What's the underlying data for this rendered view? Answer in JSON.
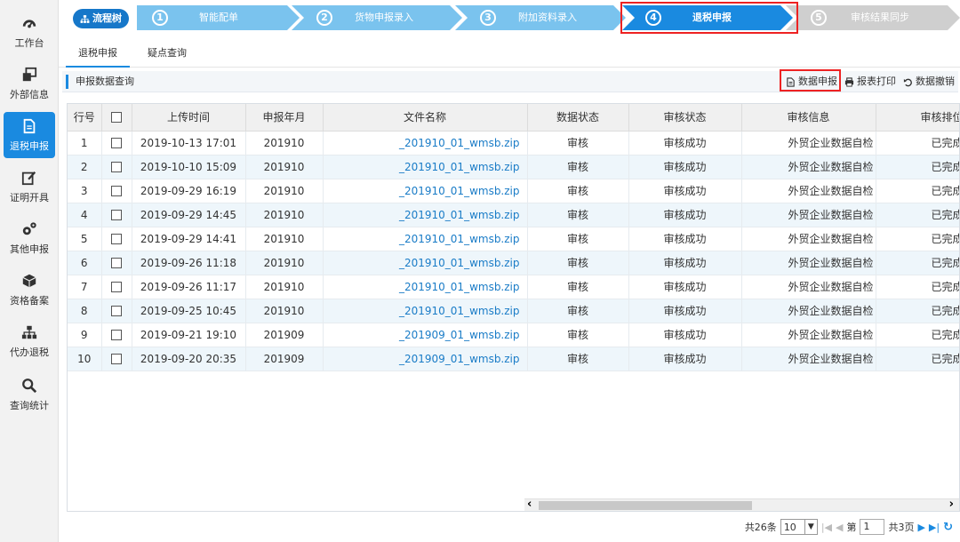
{
  "sidebar": {
    "items": [
      {
        "label": "工作台",
        "icon": "dashboard-icon"
      },
      {
        "label": "外部信息",
        "icon": "windows-icon"
      },
      {
        "label": "退税申报",
        "icon": "document-icon",
        "active": true
      },
      {
        "label": "证明开具",
        "icon": "edit-icon"
      },
      {
        "label": "其他申报",
        "icon": "gears-icon"
      },
      {
        "label": "资格备案",
        "icon": "cube-icon"
      },
      {
        "label": "代办退税",
        "icon": "sitemap-icon"
      },
      {
        "label": "查询统计",
        "icon": "search-icon"
      }
    ]
  },
  "stepbar": {
    "tree_label": "流程树",
    "steps": [
      {
        "num": "1",
        "label": "智能配单"
      },
      {
        "num": "2",
        "label": "货物申报录入"
      },
      {
        "num": "3",
        "label": "附加资料录入"
      },
      {
        "num": "4",
        "label": "退税申报",
        "active": true
      },
      {
        "num": "5",
        "label": "审核结果同步"
      }
    ]
  },
  "tabs": [
    {
      "label": "退税申报",
      "active": true
    },
    {
      "label": "疑点查询"
    }
  ],
  "toolbar": {
    "title": "申报数据查询",
    "declare_label": "数据申报",
    "print_label": "报表打印",
    "revoke_label": "数据撤销"
  },
  "table": {
    "columns": [
      "行号",
      "",
      "上传时间",
      "申报年月",
      "文件名称",
      "数据状态",
      "审核状态",
      "审核信息",
      "审核排位"
    ],
    "rows": [
      [
        "1",
        "2019-10-13 17:01",
        "201910",
        "_201910_01_wmsb.zip",
        "审核",
        "审核成功",
        "外贸企业数据自检",
        "已完成"
      ],
      [
        "2",
        "2019-10-10 15:09",
        "201910",
        "_201910_01_wmsb.zip",
        "审核",
        "审核成功",
        "外贸企业数据自检",
        "已完成"
      ],
      [
        "3",
        "2019-09-29 16:19",
        "201910",
        "_201910_01_wmsb.zip",
        "审核",
        "审核成功",
        "外贸企业数据自检",
        "已完成"
      ],
      [
        "4",
        "2019-09-29 14:45",
        "201910",
        "_201910_01_wmsb.zip",
        "审核",
        "审核成功",
        "外贸企业数据自检",
        "已完成"
      ],
      [
        "5",
        "2019-09-29 14:41",
        "201910",
        "_201910_01_wmsb.zip",
        "审核",
        "审核成功",
        "外贸企业数据自检",
        "已完成"
      ],
      [
        "6",
        "2019-09-26 11:18",
        "201910",
        "_201910_01_wmsb.zip",
        "审核",
        "审核成功",
        "外贸企业数据自检",
        "已完成"
      ],
      [
        "7",
        "2019-09-26 11:17",
        "201910",
        "_201910_01_wmsb.zip",
        "审核",
        "审核成功",
        "外贸企业数据自检",
        "已完成"
      ],
      [
        "8",
        "2019-09-25 10:45",
        "201910",
        "_201910_01_wmsb.zip",
        "审核",
        "审核成功",
        "外贸企业数据自检",
        "已完成"
      ],
      [
        "9",
        "2019-09-21 19:10",
        "201909",
        "_201909_01_wmsb.zip",
        "审核",
        "审核成功",
        "外贸企业数据自检",
        "已完成"
      ],
      [
        "10",
        "2019-09-20 20:35",
        "201909",
        "_201909_01_wmsb.zip",
        "审核",
        "审核成功",
        "外贸企业数据自检",
        "已完成"
      ]
    ]
  },
  "pager": {
    "total": "共26条",
    "page_size": "10",
    "page_prefix": "第",
    "page_value": "1",
    "page_suffix": "共3页"
  },
  "colors": {
    "primary": "#1a8ae0",
    "step_active": "#1a8ae0",
    "step_inactive": "#7ac3ee",
    "step_disabled": "#cfcfcf",
    "highlight_box": "#e22222"
  }
}
